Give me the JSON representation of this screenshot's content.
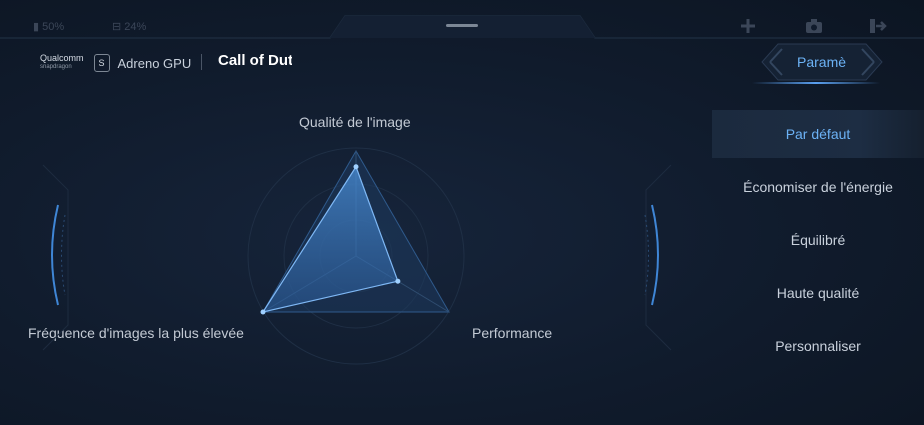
{
  "status": {
    "battery": "50%",
    "temperature": "24%"
  },
  "header": {
    "brand_name": "Qualcomm",
    "brand_sub": "snapdragon",
    "gpu_label": "Adreno GPU",
    "game_title": "Call of Dut",
    "params_tab": "Paramè",
    "top_icons": [
      "add-icon",
      "camera-icon",
      "exit-icon"
    ]
  },
  "radar": {
    "labels": {
      "quality": "Qualité de l'image",
      "fps": "Fréquence d'images la plus élevée",
      "performance": "Performance"
    },
    "values": {
      "quality": 0.85,
      "fps": 1.0,
      "performance": 0.45
    }
  },
  "modes": [
    {
      "label": "Par défaut",
      "active": true
    },
    {
      "label": "Économiser de l'énergie",
      "active": false
    },
    {
      "label": "Équilibré",
      "active": false
    },
    {
      "label": "Haute qualité",
      "active": false
    },
    {
      "label": "Personnaliser",
      "active": false
    }
  ],
  "colors": {
    "accent": "#6cb2f5",
    "background": "#101b2c",
    "text": "#c9d1dc"
  }
}
